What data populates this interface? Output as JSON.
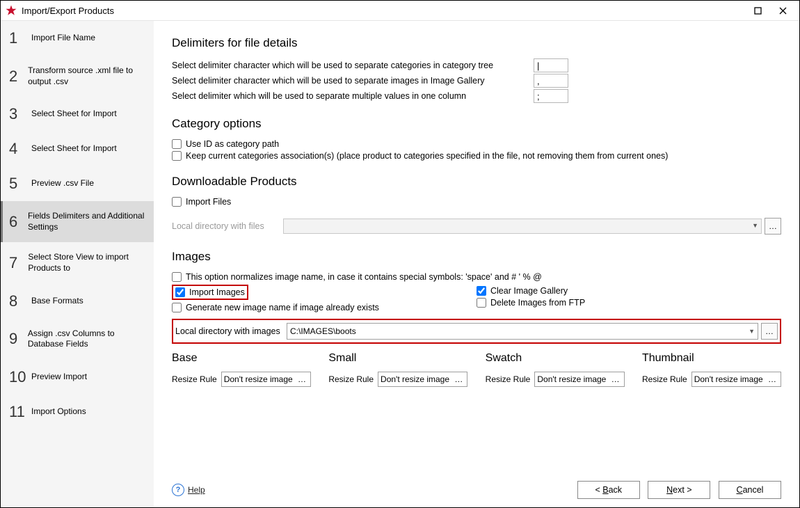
{
  "window": {
    "title": "Import/Export Products"
  },
  "steps": [
    {
      "num": "1",
      "label": "Import File Name"
    },
    {
      "num": "2",
      "label": "Transform source .xml file to output .csv"
    },
    {
      "num": "3",
      "label": "Select Sheet for Import"
    },
    {
      "num": "4",
      "label": "Select Sheet for Import"
    },
    {
      "num": "5",
      "label": "Preview .csv File"
    },
    {
      "num": "6",
      "label": "Fields Delimiters and Additional Settings"
    },
    {
      "num": "7",
      "label": "Select Store View to import Products to"
    },
    {
      "num": "8",
      "label": "Base Formats"
    },
    {
      "num": "9",
      "label": "Assign .csv Columns to Database Fields"
    },
    {
      "num": "10",
      "label": "Preview Import"
    },
    {
      "num": "11",
      "label": "Import Options"
    }
  ],
  "sections": {
    "delimiters_title": "Delimiters for file details",
    "delim_cat_label": "Select delimiter character which will be used to separate categories in category tree",
    "delim_cat_value": "|",
    "delim_img_label": "Select delimiter character which will be used to separate images in Image Gallery",
    "delim_img_value": ",",
    "delim_multi_label": "Select delimiter which will be used to separate multiple values in one column",
    "delim_multi_value": ";",
    "category_title": "Category options",
    "use_id_label": "Use ID as category path",
    "keep_assoc_label": "Keep current categories association(s) (place product to categories specified in the file, not removing them from current ones)",
    "download_title": "Downloadable Products",
    "import_files_label": "Import Files",
    "local_files_label": "Local directory with files",
    "images_title": "Images",
    "normalizes_label": "This option normalizes image name, in case it contains special symbols: 'space' and # ' % @",
    "import_images_label": "Import Images",
    "clear_gallery_label": "Clear Image Gallery",
    "gen_name_label": "Generate new image name if image already exists",
    "delete_ftp_label": "Delete Images from FTP",
    "local_images_label": "Local directory with images",
    "local_images_path": "C:\\IMAGES\\boots",
    "resize_rule": "Resize Rule",
    "resize_value": "Don't resize image",
    "img_types": {
      "base": "Base",
      "small": "Small",
      "swatch": "Swatch",
      "thumbnail": "Thumbnail"
    }
  },
  "footer": {
    "help": "Help",
    "back": "< Back",
    "next": "Next >",
    "cancel": "Cancel",
    "back_key": "B",
    "next_key": "N",
    "cancel_key": "C"
  }
}
